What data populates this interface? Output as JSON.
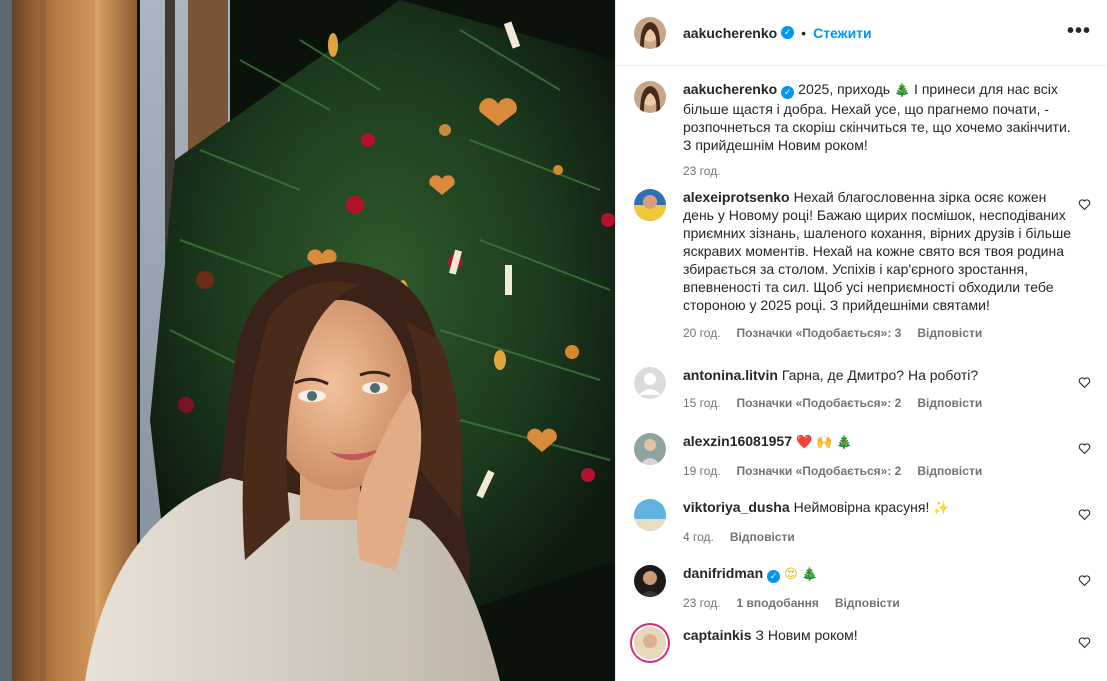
{
  "post": {
    "author": "aakucherenko",
    "follow_label": "Стежити",
    "more_label": "•••",
    "separator": "•"
  },
  "caption": {
    "user": "aakucherenko",
    "text_before_emoji": "2025, приходь",
    "emoji": "🎄",
    "text_after_emoji": "І принеси для нас всіх більше щастя і добра. Нехай усе, що прагнемо почати, - розпочнеться та скоріш скінчиться те, що хочемо закінчити. З прийдешнім Новим роком!",
    "time": "23 год."
  },
  "comments": [
    {
      "user": "alexeiprotsenko",
      "text": "Нехай благословенна зірка осяє кожен день у Новому році! Бажаю щирих посмішок, несподіваних приємних зізнань, шаленого кохання, вірних друзів і більше яскравих моментів. Нехай на кожне свято вся твоя родина збирається за столом. Успіхів і кар'єрного зростання, впевненості та сил. Щоб усі неприємності обходили тебе стороною у 2025 році. З прийдешніми святами!",
      "time": "20 год.",
      "likes": "Позначки «Подобається»: 3",
      "reply": "Відповісти"
    },
    {
      "user": "antonina.litvin",
      "text": "Гарна, де Дмитро? На роботі?",
      "time": "15 год.",
      "likes": "Позначки «Подобається»: 2",
      "reply": "Відповісти"
    },
    {
      "user": "alexzin16081957",
      "emojis": [
        "❤️",
        "🙌",
        "🎄"
      ],
      "time": "19 год.",
      "likes": "Позначки «Подобається»: 2",
      "reply": "Відповісти"
    },
    {
      "user": "viktoriya_dusha",
      "text": "Неймовірна красуня!",
      "emojis": [
        "✨"
      ],
      "time": "4 год.",
      "reply": "Відповісти"
    },
    {
      "user": "danifridman",
      "emojis": [
        "😍",
        "🎄"
      ],
      "time": "23 год.",
      "likes": "1 вподобання",
      "reply": "Відповісти"
    },
    {
      "user": "captainkis",
      "text": "З Новим роком!"
    }
  ],
  "colors": {
    "accent": "#0095f6",
    "text": "#262626",
    "meta": "#737373",
    "border": "#efefef"
  },
  "icons": {
    "more": "more-dots-icon",
    "verified": "verified-badge-icon",
    "like": "heart-outline-icon"
  }
}
